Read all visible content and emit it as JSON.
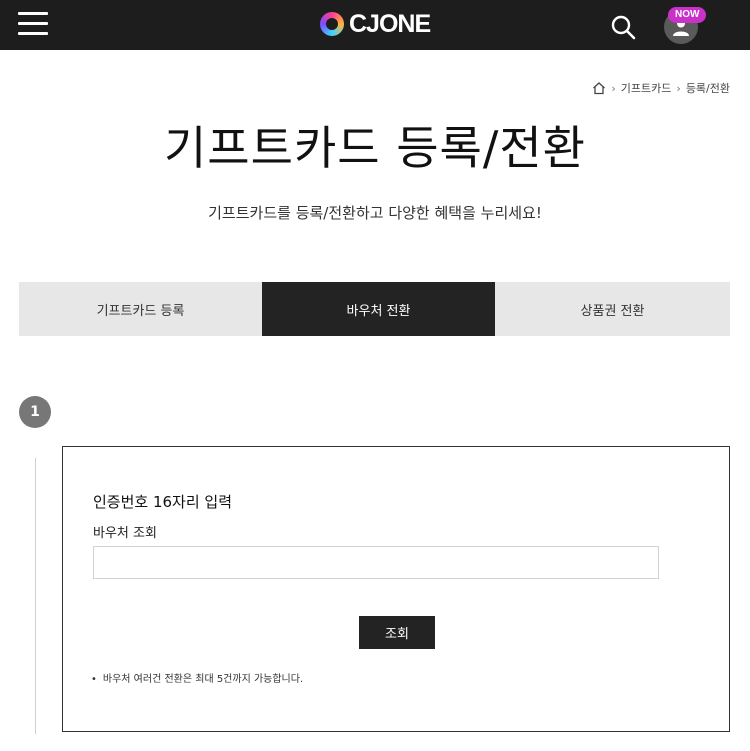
{
  "header": {
    "logo_text": "CJONE",
    "now_badge": "NOW",
    "menu_icon": "hamburger-menu-icon",
    "search_icon": "search-icon",
    "profile_icon": "user-icon",
    "background_color": "#1d1d1d"
  },
  "breadcrumb": {
    "home_icon": "home-icon",
    "items": [
      "기프트카드",
      "등록/전환"
    ]
  },
  "page": {
    "title": "기프트카드 등록/전환",
    "subtitle": "기프트카드를 등록/전환하고 다양한 혜택을 누리세요!"
  },
  "tabs": [
    {
      "label": "기프트카드 등록",
      "active": false
    },
    {
      "label": "바우처 전환",
      "active": true
    },
    {
      "label": "상품권 전환",
      "active": false
    }
  ],
  "step": {
    "number": "1"
  },
  "form": {
    "heading": "인증번호 16자리 입력",
    "label": "바우처 조회",
    "input_value": "",
    "input_placeholder": "",
    "button_label": "조회",
    "note_bullet": "•",
    "note": "바우처 여러건 전환은 최대 5건까지 가능합니다."
  },
  "colors": {
    "active_tab": "#232323",
    "inactive_tab": "#e7e7e7",
    "step_circle": "#777777",
    "now_badge": "#c931c9"
  }
}
